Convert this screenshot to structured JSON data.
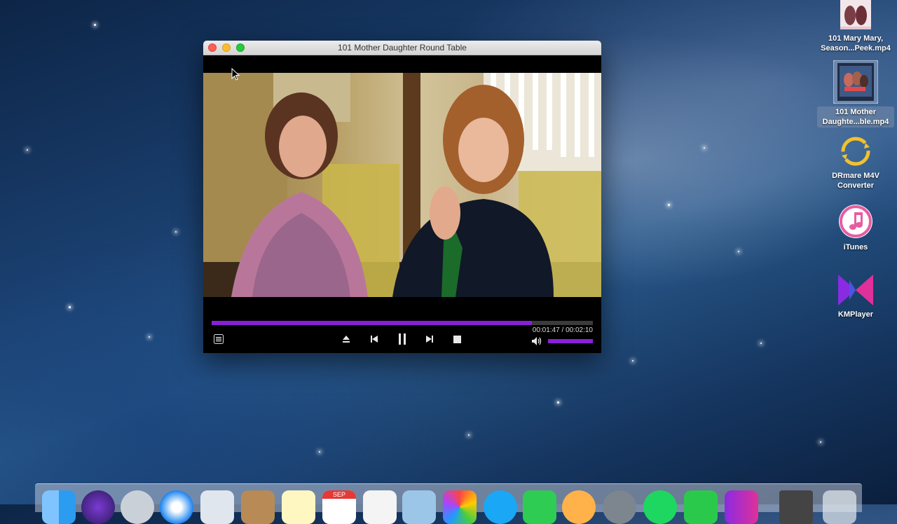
{
  "window": {
    "title": "101 Mother Daughter Round Table"
  },
  "player": {
    "progress_fraction": 0.8395,
    "volume_fraction": 1.0,
    "elapsed": "00:01:47",
    "separator": "/",
    "duration": "00:02:10",
    "accent": "#8a1fd9"
  },
  "desktop": {
    "icons": [
      {
        "label_line1": "101 Mary Mary,",
        "label_line2": "Season...Peek.mp4",
        "icon": "video-thumbnail-icon"
      },
      {
        "label_line1": "101 Mother",
        "label_line2": "Daughte...ble.mp4",
        "icon": "video-thumbnail-icon"
      },
      {
        "label_line1": "DRmare M4V",
        "label_line2": "Converter",
        "icon": "drmare-app-icon"
      },
      {
        "label_line1": "iTunes",
        "label_line2": "",
        "icon": "itunes-icon"
      },
      {
        "label_line1": "KMPlayer",
        "label_line2": "",
        "icon": "kmplayer-icon"
      }
    ]
  },
  "dock": {
    "calendar_month": "SEP"
  }
}
